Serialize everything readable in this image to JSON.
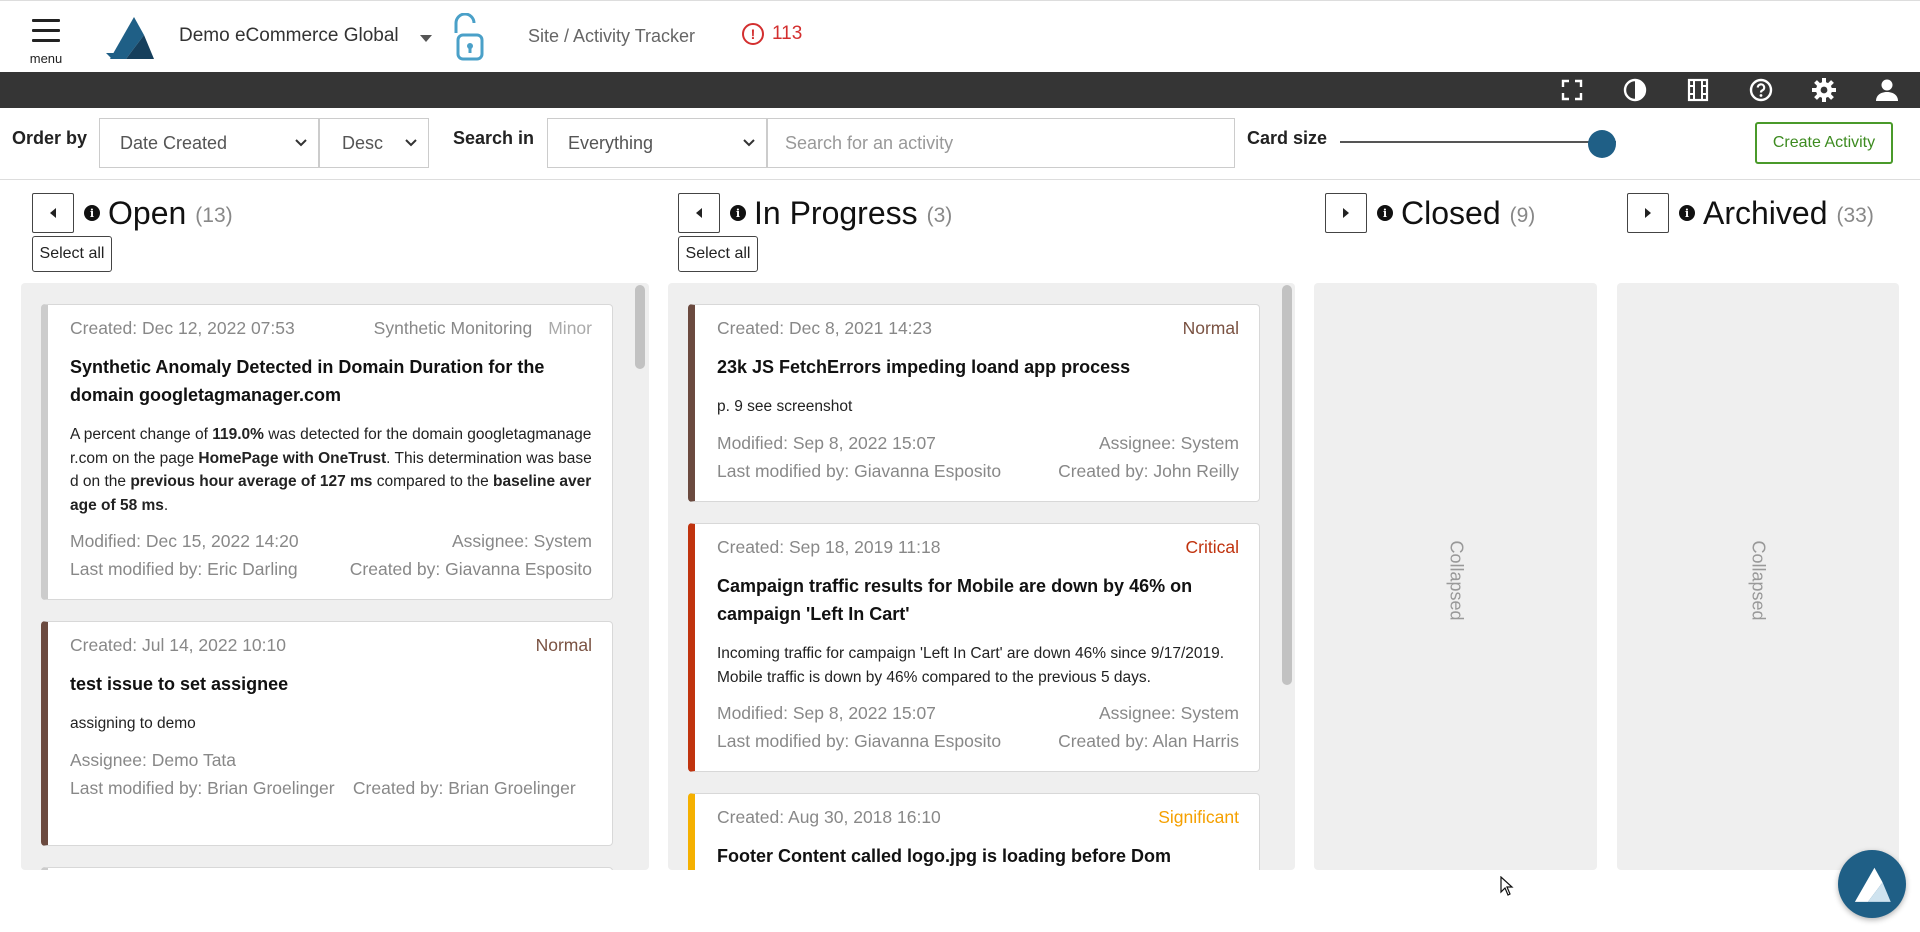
{
  "header": {
    "menu_label": "menu",
    "org_name": "Demo eCommerce Global",
    "breadcrumb": "Site / Activity Tracker",
    "alert_count": "113"
  },
  "toolbar_icons": [
    "fullscreen-icon",
    "contrast-icon",
    "film-icon",
    "help-icon",
    "gear-icon",
    "user-icon"
  ],
  "controls": {
    "order_by_label": "Order by",
    "order_by_value": "Date Created",
    "order_dir_value": "Desc",
    "search_in_label": "Search in",
    "search_in_value": "Everything",
    "search_placeholder": "Search for an activity",
    "card_size_label": "Card size",
    "card_size_fraction": 0.95,
    "create_label": "Create Activity"
  },
  "columns": {
    "open": {
      "title": "Open",
      "count": "(13)",
      "select_all": "Select all"
    },
    "in_progress": {
      "title": "In Progress",
      "count": "(3)",
      "select_all": "Select all"
    },
    "closed": {
      "title": "Closed",
      "count": "(9)",
      "collapsed_label": "Collapsed"
    },
    "archived": {
      "title": "Archived",
      "count": "(33)",
      "collapsed_label": "Collapsed"
    }
  },
  "open_cards": [
    {
      "created": "Created: Dec 12, 2022 07:53",
      "source": "Synthetic Monitoring",
      "severity": "Minor",
      "severity_color": "#bbbbbb",
      "title": "Synthetic Anomaly Detected in Domain Duration for the domain googletagmanager.com",
      "desc_parts": {
        "p1": "A percent change of ",
        "b1": "119.0%",
        "p2": " was detected for the domain googletagmanager.com on the page ",
        "b2": "HomePage with OneTrust",
        "p3": ". This determination was based on the ",
        "b3": "previous hour average of 127 ms",
        "p4": " compared to the ",
        "b4": "baseline average of 58 ms",
        "p5": "."
      },
      "modified": "Modified: Dec 15, 2022 14:20",
      "assignee": "Assignee: System",
      "last_modified_by": "Last modified by: Eric Darling",
      "created_by": "Created by: Giavanna Esposito"
    },
    {
      "created": "Created: Jul 14, 2022 10:10",
      "severity": "Normal",
      "severity_color": "#6b4a3f",
      "title": "test issue to set assignee",
      "desc": "assigning to demo",
      "assignee": "Assignee: Demo Tata",
      "last_modified_by": "Last modified by: Brian Groelinger",
      "created_by": "Created by: Brian Groelinger"
    }
  ],
  "progress_cards": [
    {
      "created": "Created: Dec 8, 2021 14:23",
      "severity": "Normal",
      "severity_color": "#6b4a3f",
      "title": "23k JS FetchErrors impeding loand app process",
      "desc": "p. 9 see screenshot",
      "modified": "Modified: Sep 8, 2022 15:07",
      "assignee": "Assignee: System",
      "last_modified_by": "Last modified by: Giavanna Esposito",
      "created_by": "Created by: John Reilly"
    },
    {
      "created": "Created: Sep 18, 2019 11:18",
      "severity": "Critical",
      "severity_color": "#c0330e",
      "title": "Campaign traffic results for Mobile are down by 46% on campaign 'Left In Cart'",
      "desc": "Incoming traffic for campaign 'Left In Cart' are down 46% since 9/17/2019. Mobile traffic is down by 46% compared to the previous 5 days.",
      "modified": "Modified: Sep 8, 2022 15:07",
      "assignee": "Assignee: System",
      "last_modified_by": "Last modified by: Giavanna Esposito",
      "created_by": "Created by: Alan Harris"
    },
    {
      "created": "Created: Aug 30, 2018 16:10",
      "severity": "Significant",
      "severity_color": "#f5b000",
      "title": "Footer Content called logo.jpg is loading before Dom"
    }
  ]
}
